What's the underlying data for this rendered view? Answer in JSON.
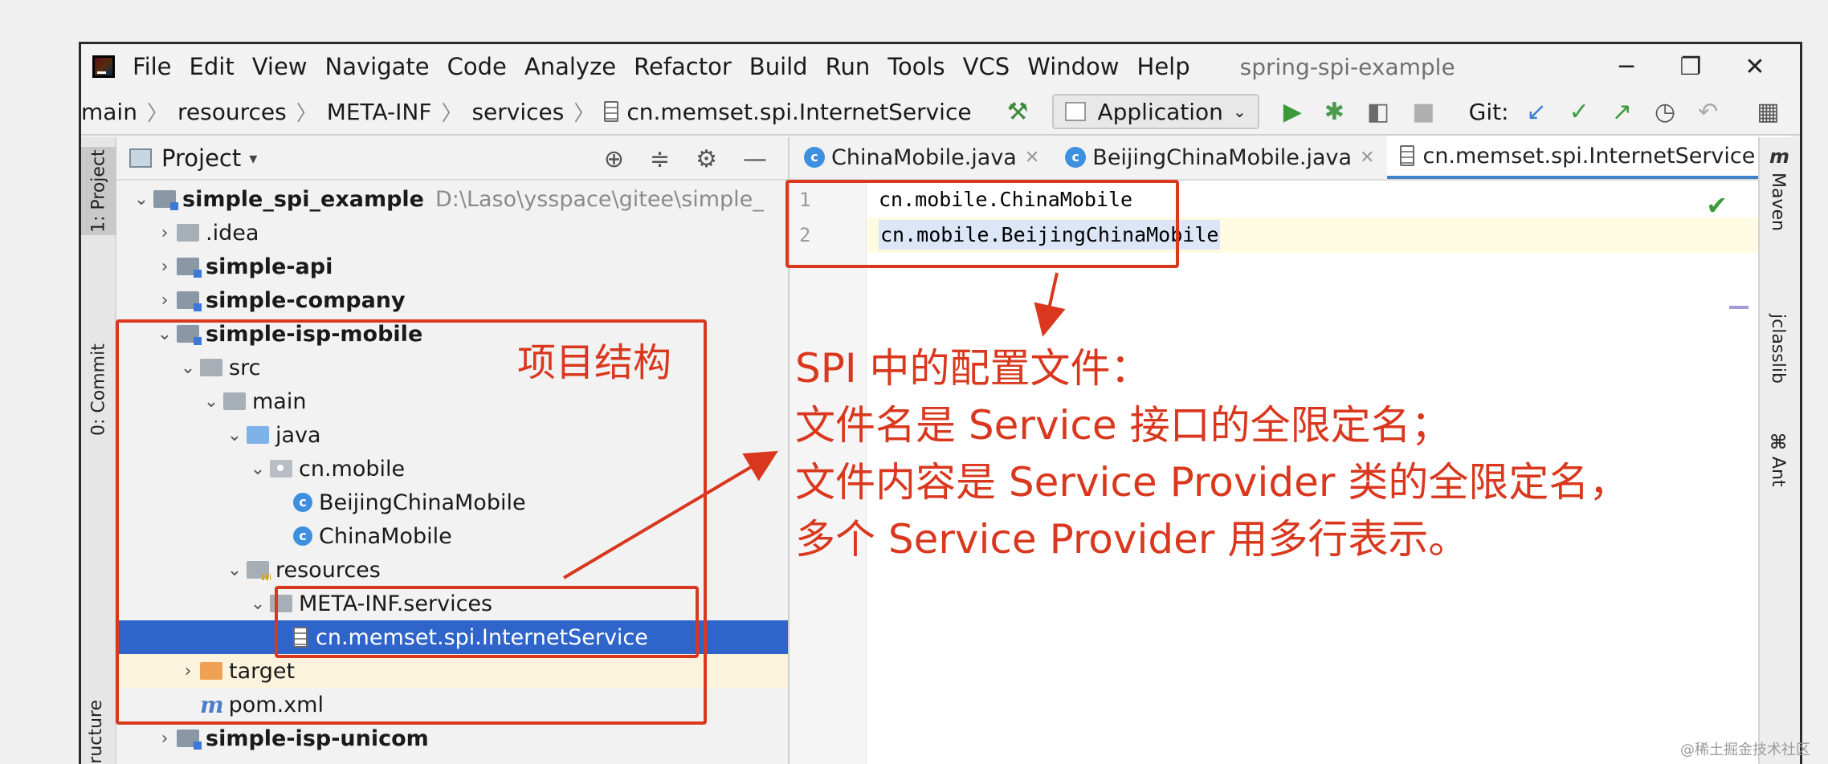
{
  "slide": {
    "title_fragment": "SPI Spi"
  },
  "menu": {
    "items": [
      "File",
      "Edit",
      "View",
      "Navigate",
      "Code",
      "Analyze",
      "Refactor",
      "Build",
      "Run",
      "Tools",
      "VCS",
      "Window",
      "Help"
    ],
    "project_title": "spring-spi-example"
  },
  "window_controls": {
    "minimize": "─",
    "restore": "❐",
    "close": "✕"
  },
  "breadcrumb": [
    "main",
    "resources",
    "META-INF",
    "services",
    "cn.memset.spi.InternetService"
  ],
  "toolbar": {
    "run_config": "Application",
    "git_label": "Git:"
  },
  "left_stripe": {
    "project_tab": "1: Project",
    "commit_tab": "0: Commit",
    "structure_tab": "ructure"
  },
  "project_panel": {
    "title": "Project",
    "tree": [
      {
        "label": "simple_spi_example",
        "hint": "D:\\Laso\\ysspace\\gitee\\simple_",
        "indent": 0,
        "arrow": "⌄",
        "icon": "module",
        "bold": true
      },
      {
        "label": ".idea",
        "indent": 1,
        "arrow": "›",
        "icon": "folder"
      },
      {
        "label": "simple-api",
        "indent": 1,
        "arrow": "›",
        "icon": "module",
        "bold": true
      },
      {
        "label": "simple-company",
        "indent": 1,
        "arrow": "›",
        "icon": "module",
        "bold": true
      },
      {
        "label": "simple-isp-mobile",
        "indent": 1,
        "arrow": "⌄",
        "icon": "module",
        "bold": true
      },
      {
        "label": "src",
        "indent": 2,
        "arrow": "⌄",
        "icon": "folder"
      },
      {
        "label": "main",
        "indent": 3,
        "arrow": "⌄",
        "icon": "folder"
      },
      {
        "label": "java",
        "indent": 4,
        "arrow": "⌄",
        "icon": "src"
      },
      {
        "label": "cn.mobile",
        "indent": 5,
        "arrow": "⌄",
        "icon": "pkg"
      },
      {
        "label": "BeijingChinaMobile",
        "indent": 6,
        "arrow": "",
        "icon": "class"
      },
      {
        "label": "ChinaMobile",
        "indent": 6,
        "arrow": "",
        "icon": "class"
      },
      {
        "label": "resources",
        "indent": 4,
        "arrow": "⌄",
        "icon": "res"
      },
      {
        "label": "META-INF.services",
        "indent": 5,
        "arrow": "⌄",
        "icon": "folder"
      },
      {
        "label": "cn.memset.spi.InternetService",
        "indent": 6,
        "arrow": "",
        "icon": "file",
        "selected": true
      },
      {
        "label": "target",
        "indent": 2,
        "arrow": "›",
        "icon": "target"
      },
      {
        "label": "pom.xml",
        "indent": 2,
        "arrow": "",
        "icon": "maven"
      },
      {
        "label": "simple-isp-unicom",
        "indent": 1,
        "arrow": "›",
        "icon": "module",
        "bold": true
      }
    ]
  },
  "editor": {
    "tabs": [
      {
        "label": "ChinaMobile.java",
        "icon": "class"
      },
      {
        "label": "BeijingChinaMobile.java",
        "icon": "class"
      },
      {
        "label": "cn.memset.spi.InternetService",
        "icon": "file",
        "active": true
      }
    ],
    "lines": [
      {
        "no": "1",
        "text": "cn.mobile.ChinaMobile"
      },
      {
        "no": "2",
        "text": "cn.mobile.BeijingChinaMobile"
      }
    ]
  },
  "right_stripe": {
    "maven": "Maven",
    "jclasslib": "jclasslib",
    "ant": "Ant"
  },
  "annotations": {
    "structure_label": "项目结构",
    "explanation": [
      "SPI 中的配置文件：",
      "文件名是 Service 接口的全限定名；",
      "文件内容是 Service Provider 类的全限定名，",
      "多个 Service Provider 用多行表示。"
    ],
    "color": "#d9381e"
  },
  "watermark": "@稀土掘金技术社区"
}
